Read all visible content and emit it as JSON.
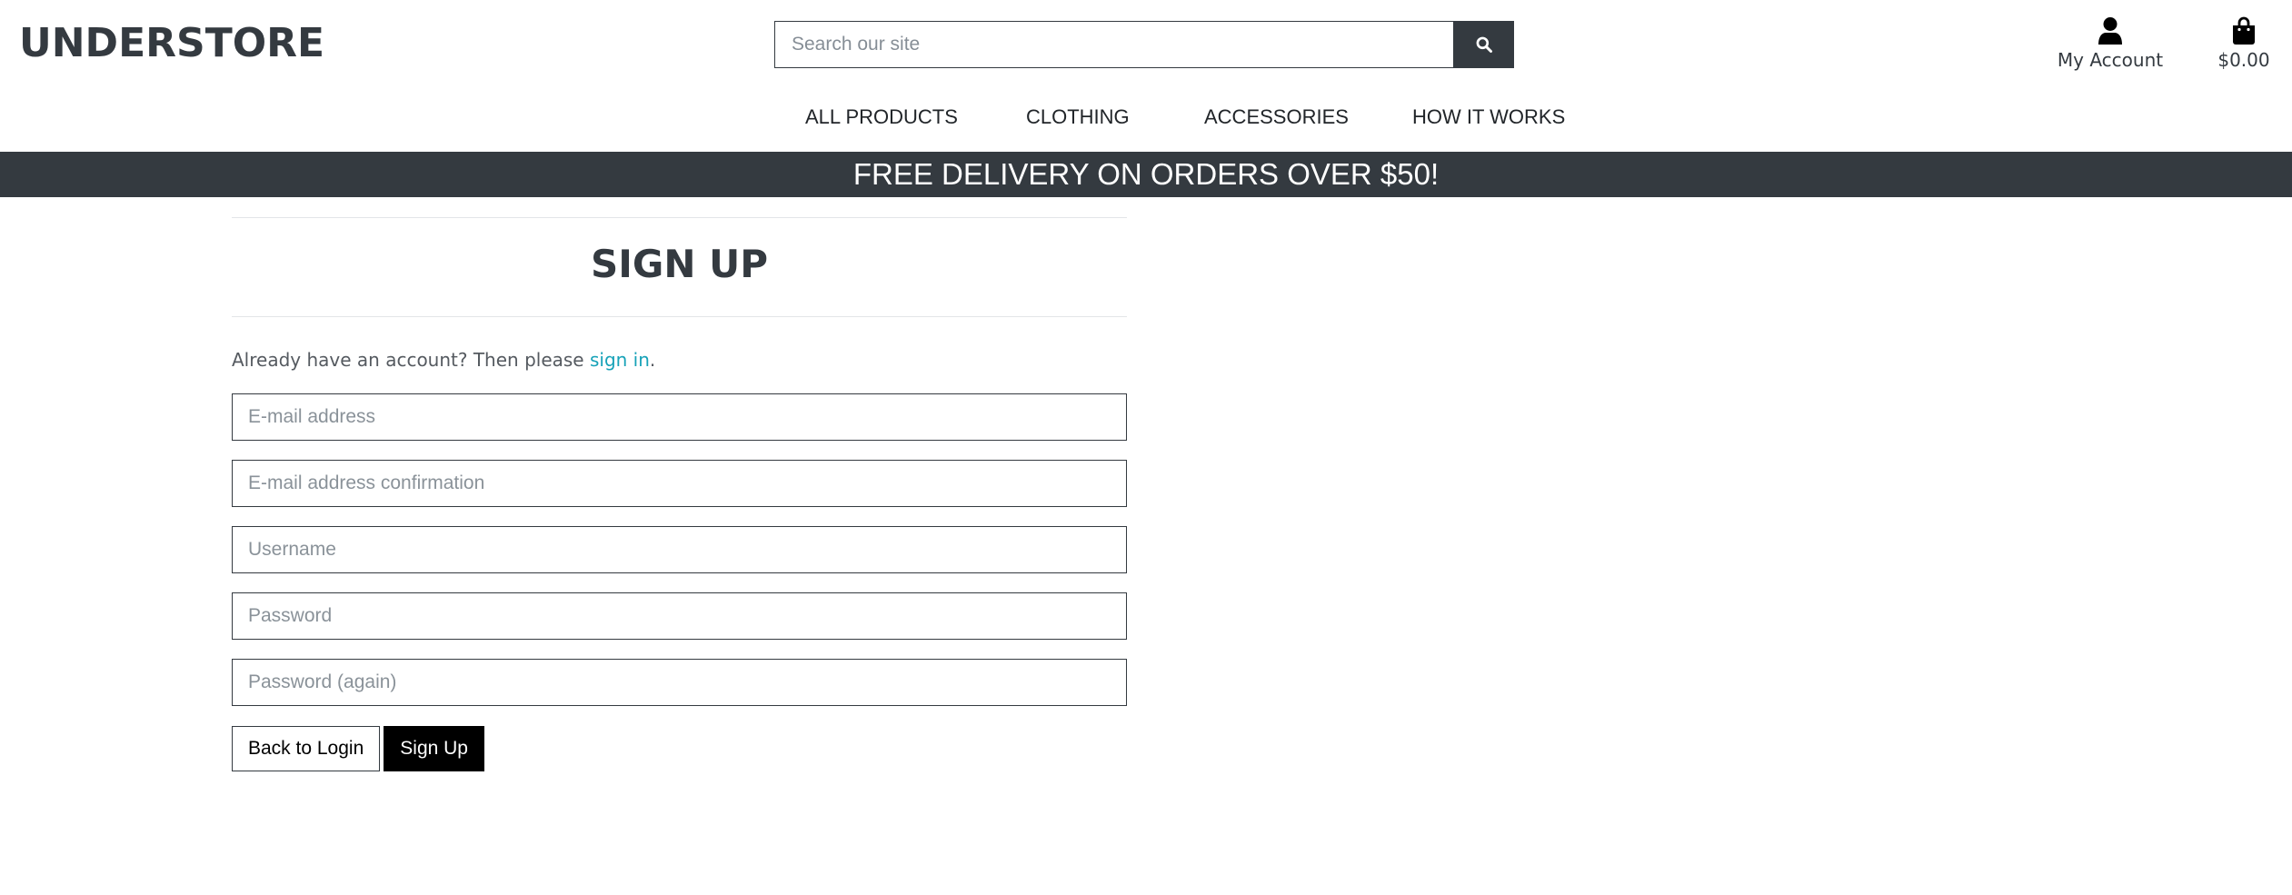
{
  "brand": {
    "name": "UNDERSTORE"
  },
  "search": {
    "placeholder": "Search our site",
    "icon": "search-icon"
  },
  "account": {
    "label": "My Account",
    "icon": "user-icon"
  },
  "cart": {
    "total": "$0.00",
    "icon": "shopping-bag-icon"
  },
  "nav": {
    "items": [
      "ALL PRODUCTS",
      "CLOTHING",
      "ACCESSORIES",
      "HOW IT WORKS"
    ]
  },
  "banner": {
    "text": "FREE DELIVERY ON ORDERS OVER $50!"
  },
  "signup": {
    "title": "SIGN UP",
    "intro_text": "Already have an account? Then please ",
    "signin_link": "sign in",
    "intro_suffix": ".",
    "fields": {
      "email": "E-mail address",
      "email_confirm": "E-mail address confirmation",
      "username": "Username",
      "password": "Password",
      "password_again": "Password (again)"
    },
    "back_button": "Back to Login",
    "submit_button": "Sign Up"
  },
  "colors": {
    "dark": "#343a40",
    "link": "#17a2b8",
    "button_primary": "#000000",
    "background": "#ffffff"
  }
}
